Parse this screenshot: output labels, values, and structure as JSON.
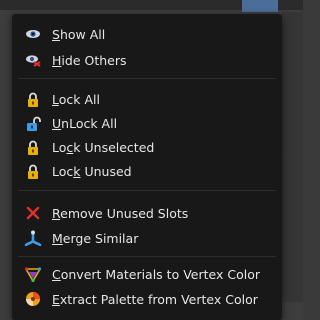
{
  "menu": {
    "items": [
      {
        "label": "Show All",
        "ul": 0,
        "icon": "eye-icon"
      },
      {
        "label": "Hide Others",
        "ul": 0,
        "icon": "hide-others-icon"
      },
      {
        "label": "Lock All",
        "ul": 0,
        "icon": "lock-icon"
      },
      {
        "label": "UnLock All",
        "ul": 0,
        "icon": "unlock-icon"
      },
      {
        "label": "Lock Unselected",
        "ul": 2,
        "icon": "lock-icon"
      },
      {
        "label": "Lock Unused",
        "ul": 3,
        "icon": "lock-icon"
      },
      {
        "label": "Remove Unused Slots",
        "ul": 0,
        "icon": "remove-x-icon"
      },
      {
        "label": "Merge Similar",
        "ul": 0,
        "icon": "merge-icon"
      },
      {
        "label": "Convert Materials to Vertex Color",
        "ul": 0,
        "icon": "vertex-color-icon"
      },
      {
        "label": "Extract Palette from Vertex Color",
        "ul": 0,
        "icon": "palette-icon"
      }
    ]
  },
  "colors": {
    "menu_bg": "#181818",
    "text": "#e6e6e6",
    "lock_yellow": "#e8b000",
    "remove_red": "#e03030",
    "merge_blue": "#3c9de6"
  }
}
